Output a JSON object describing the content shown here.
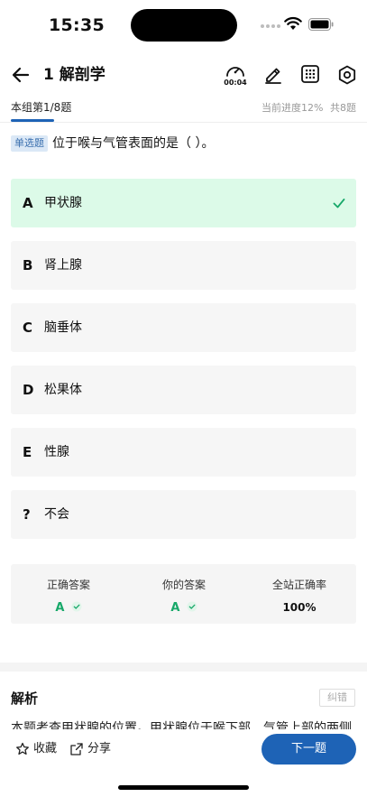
{
  "status_bar": {
    "time": "15:35"
  },
  "header": {
    "title": "1 解剖学",
    "timer": "00:04",
    "icons": [
      "back-arrow-icon",
      "timer-icon",
      "edit-icon",
      "grid-icon",
      "settings-icon"
    ]
  },
  "progress": {
    "group": "本组第1/8题",
    "current": "当前进度12%",
    "total": "共8题"
  },
  "question": {
    "type_tag": "单选题",
    "text": "位于喉与气管表面的是（ ）。"
  },
  "options": [
    {
      "letter": "A",
      "text": "甲状腺",
      "state": "correct"
    },
    {
      "letter": "B",
      "text": "肾上腺",
      "state": "normal"
    },
    {
      "letter": "C",
      "text": "脑垂体",
      "state": "normal"
    },
    {
      "letter": "D",
      "text": "松果体",
      "state": "normal"
    },
    {
      "letter": "E",
      "text": "性腺",
      "state": "normal"
    },
    {
      "letter": "?",
      "text": "不会",
      "state": "normal"
    }
  ],
  "answer_summary": {
    "correct_label": "正确答案",
    "correct_value": "A",
    "your_label": "你的答案",
    "your_value": "A",
    "rate_label": "全站正确率",
    "rate_value": "100%"
  },
  "analysis": {
    "title": "解析",
    "report_label": "纠错",
    "text": "本题考查甲状腺的位置。甲状腺位于喉下部、气管上部的两侧"
  },
  "bottom_bar": {
    "favorite_label": "收藏",
    "share_label": "分享",
    "next_label": "下一题"
  },
  "colors": {
    "accent": "#1e63b6",
    "correct_bg": "#dcfae8",
    "correct_green": "#17a869"
  }
}
